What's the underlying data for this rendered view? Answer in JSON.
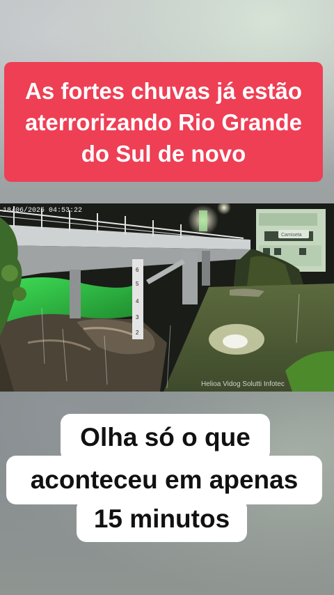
{
  "top_caption": {
    "text": "As fortes chuvas já estão aterrorizando Rio Grande do Sul de novo",
    "background": "#ee3f55"
  },
  "video": {
    "timestamp": "18/06/2025 04:53:22",
    "watermark": "Helioa Vidog   Solutti   Infotec",
    "gauge_marks": [
      "6",
      "5",
      "4",
      "3",
      "2"
    ],
    "building_sign": "Camiseta"
  },
  "bottom_caption": {
    "lines": [
      "Olha só o que",
      "aconteceu em apenas",
      "15 minutos"
    ]
  }
}
